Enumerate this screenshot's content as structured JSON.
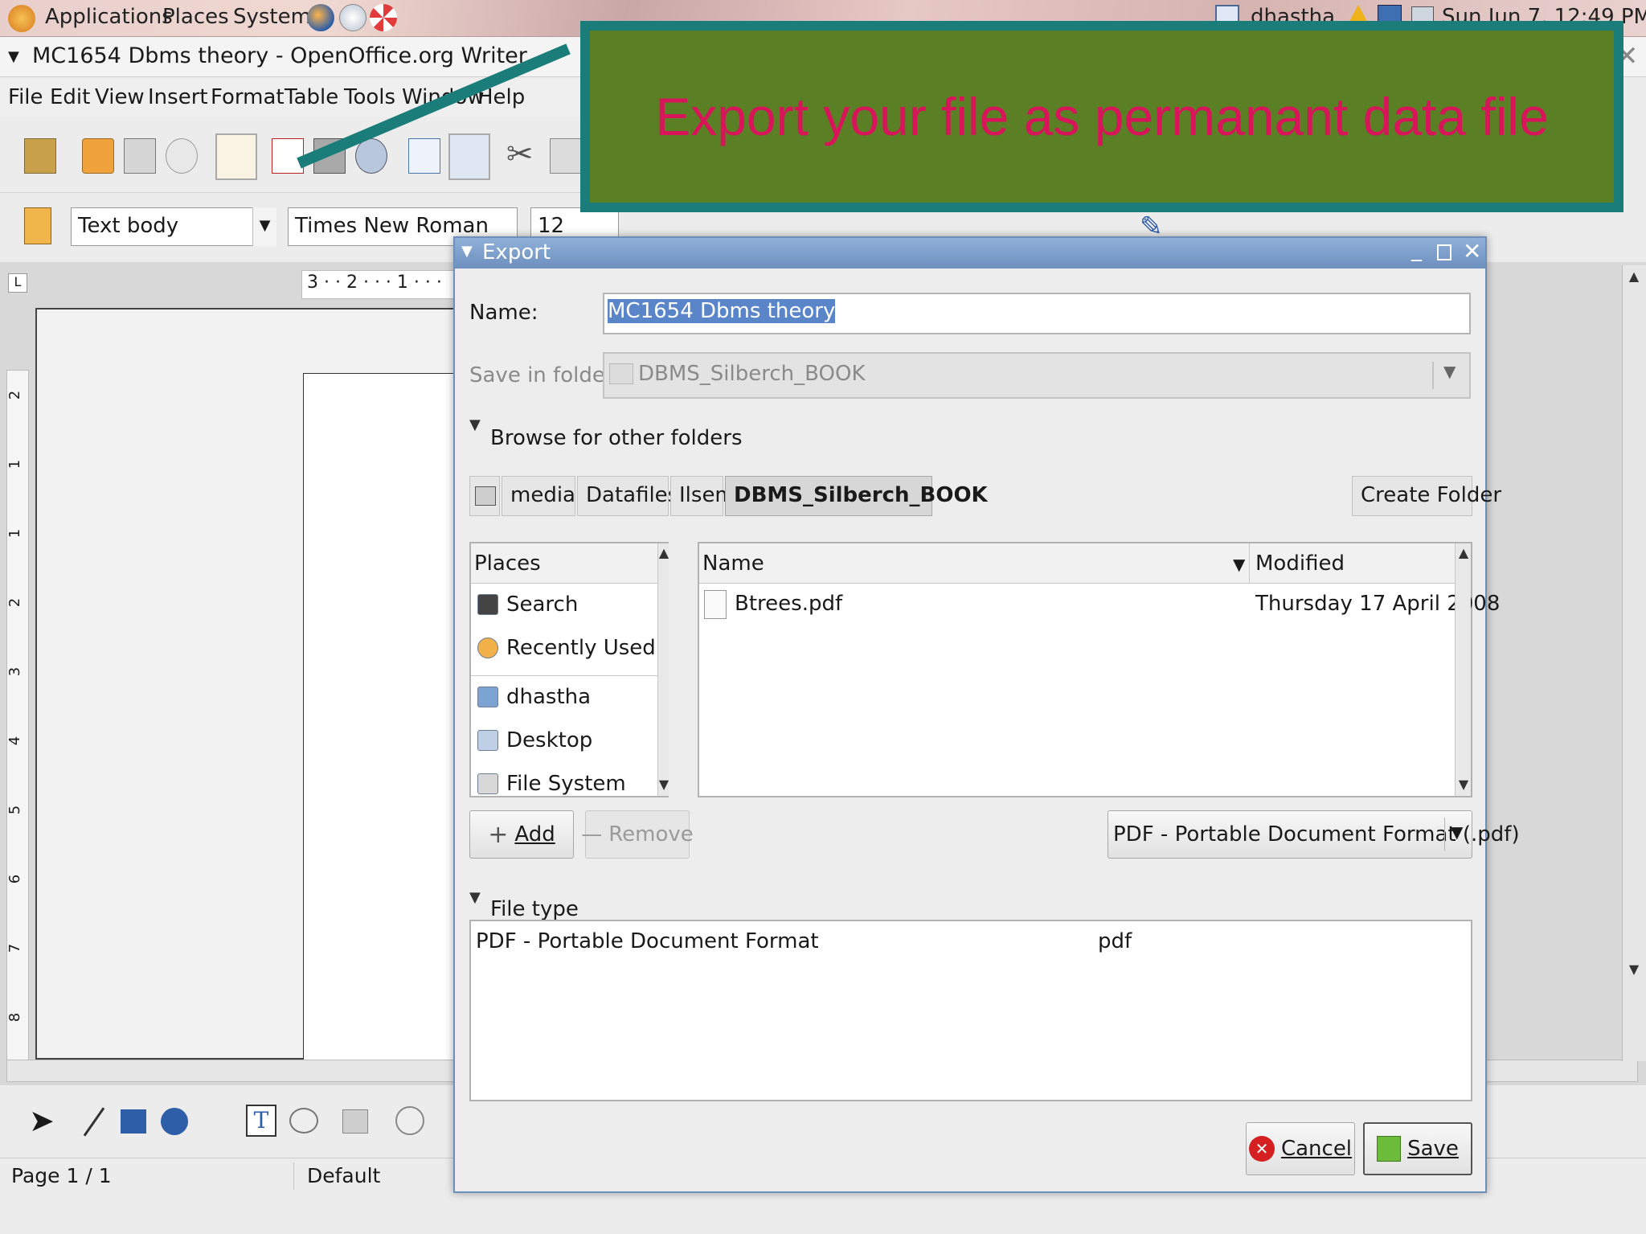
{
  "panel": {
    "applications": "Applications",
    "places": "Places",
    "system": "System",
    "user": "dhastha",
    "clock": "Sun Jun  7, 12:49 PM"
  },
  "window": {
    "title": "MC1654 Dbms theory - OpenOffice.org Writer"
  },
  "menu": [
    "File",
    "Edit",
    "View",
    "Insert",
    "Format",
    "Table",
    "Tools",
    "Window",
    "Help"
  ],
  "format_bar": {
    "style": "Text body",
    "font": "Times New Roman",
    "size": "12"
  },
  "ruler": {
    "h_text": "3 · · 2 · · · 1 · · ·",
    "v_marks": [
      "2",
      "1",
      "1",
      "2",
      "3",
      "4",
      "5",
      "6",
      "7",
      "8"
    ]
  },
  "status": {
    "page": "Page 1 / 1",
    "style": "Default"
  },
  "callout": {
    "text": "Export your file as permanant data file",
    "text_color": "#d8145a",
    "background": "#5b7f24",
    "border_color": "#1a7d7a"
  },
  "dialog": {
    "title": "Export",
    "name_label": "Name:",
    "name_value": "MC1654 Dbms theory",
    "folder_label": "Save in folder:",
    "folder_value": "DBMS_Silberch_BOOK",
    "browse_label": "Browse for other folders",
    "path": [
      "media",
      "Datafiles",
      "Ilsem",
      "DBMS_Silberch_BOOK"
    ],
    "create_folder": "Create Folder",
    "places_header": "Places",
    "places": [
      {
        "label": "Search",
        "icon": "binoculars-icon"
      },
      {
        "label": "Recently Used",
        "icon": "clock-icon"
      },
      {
        "label": "dhastha",
        "icon": "home-folder-icon"
      },
      {
        "label": "Desktop",
        "icon": "desktop-icon"
      },
      {
        "label": "File System",
        "icon": "drive-icon"
      }
    ],
    "files_headers": {
      "name": "Name",
      "modified": "Modified"
    },
    "files": [
      {
        "name": "Btrees.pdf",
        "modified": "Thursday 17 April 2008"
      }
    ],
    "add": "Add",
    "remove": "Remove",
    "filter": "PDF - Portable Document Format (.pdf)",
    "filetype_label": "File type",
    "filetype_row": {
      "name": "PDF - Portable Document Format",
      "ext": "pdf"
    },
    "cancel": "Cancel",
    "save": "Save"
  }
}
